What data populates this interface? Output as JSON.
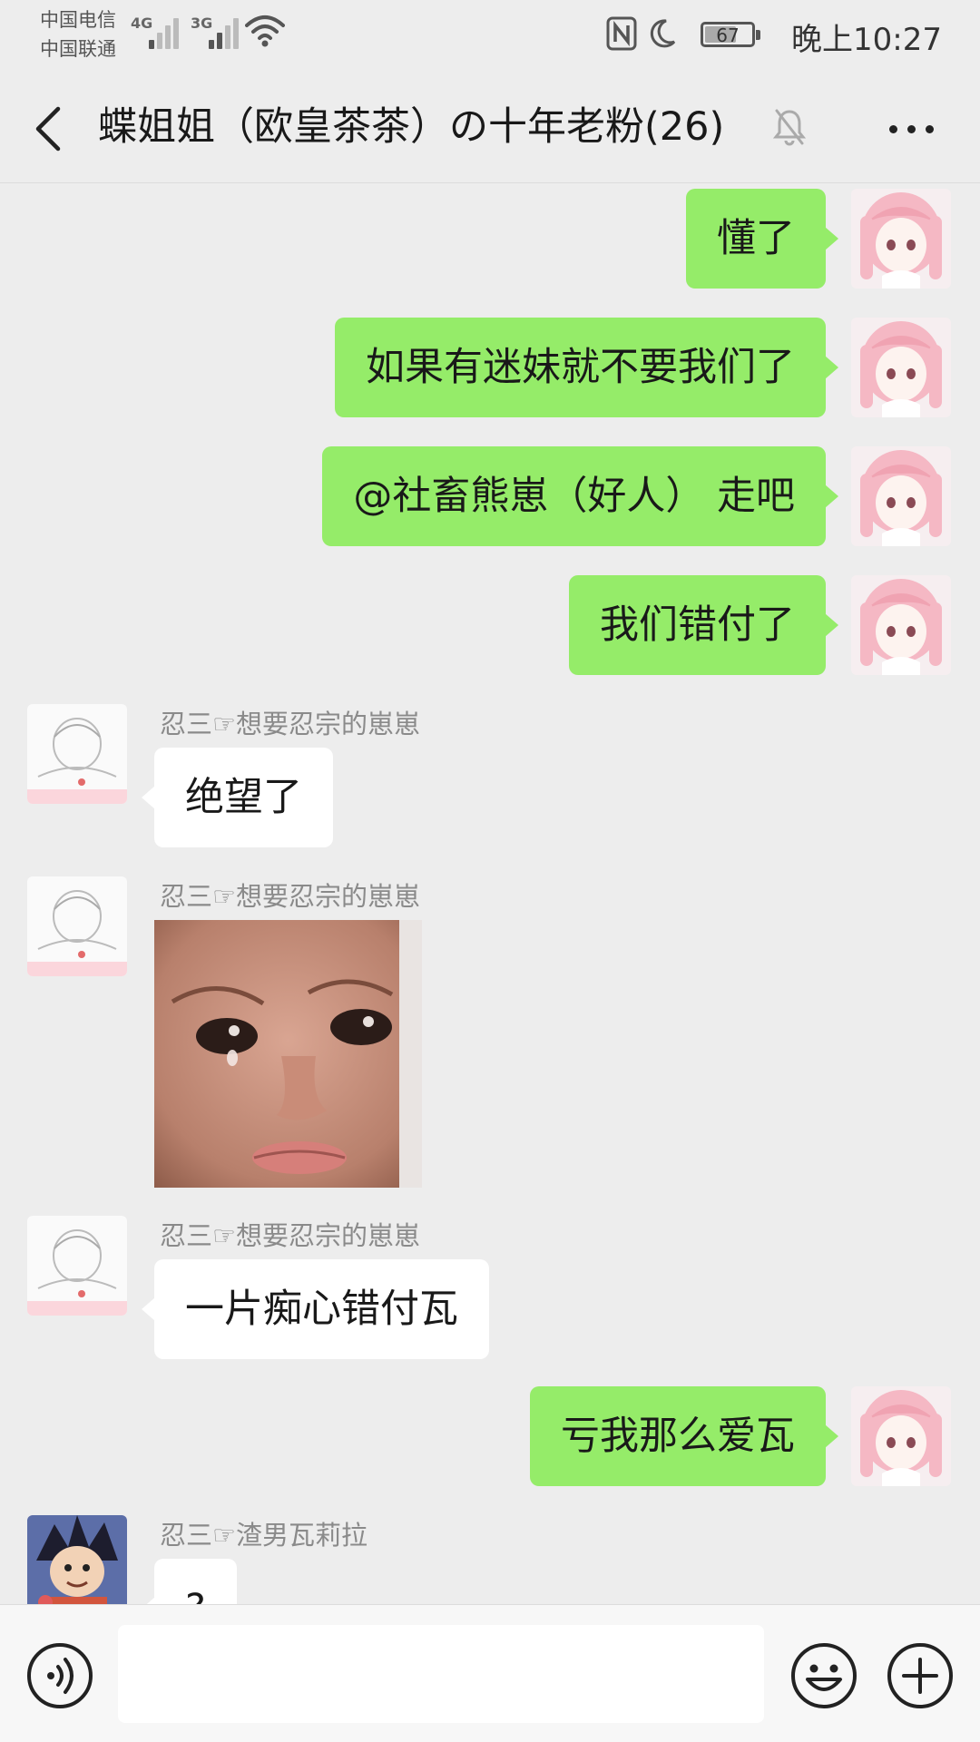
{
  "status_bar": {
    "carrier_1": "中国电信",
    "carrier_2": "中国联通",
    "network_1": "4G",
    "network_2": "3G",
    "battery": "67",
    "battery_level": 0.67,
    "time": "晚上10:27"
  },
  "header": {
    "title": "蝶姐姐（欧皇茶茶）の十年老粉(26)",
    "icons": [
      "back-icon",
      "mute-bell-icon",
      "more-icon"
    ]
  },
  "colors": {
    "background": "#ededed",
    "self_bubble": "#95ec69",
    "other_bubble": "#ffffff",
    "sender_name": "#8a8a8a"
  },
  "messages": [
    {
      "side": "self",
      "text": "懂了"
    },
    {
      "side": "self",
      "text": "如果有迷妹就不要我们了"
    },
    {
      "side": "self",
      "text": "@社畜熊崽（好人） 走吧"
    },
    {
      "side": "self",
      "text": "我们错付了"
    },
    {
      "side": "other",
      "sender": "忍三☞想要忍宗的崽崽",
      "text": "绝望了"
    },
    {
      "side": "other",
      "sender": "忍三☞想要忍宗的崽崽",
      "type": "image"
    },
    {
      "side": "other",
      "sender": "忍三☞想要忍宗的崽崽",
      "text": "一片痴心错付瓦"
    },
    {
      "side": "self",
      "text": "亏我那么爱瓦"
    },
    {
      "side": "other",
      "sender": "忍三☞渣男瓦莉拉",
      "text": "?"
    }
  ],
  "input_bar": {
    "placeholder": "",
    "icons": [
      "voice-icon",
      "emoji-icon",
      "plus-icon"
    ]
  }
}
